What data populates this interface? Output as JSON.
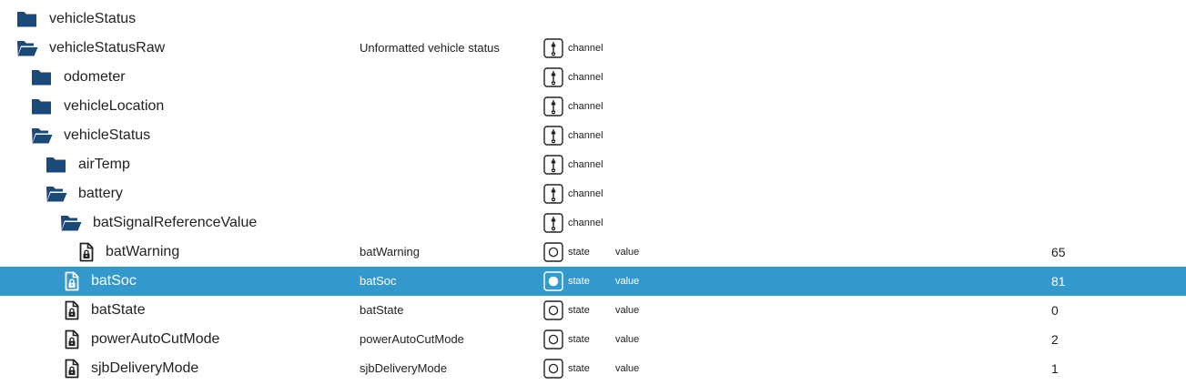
{
  "colors": {
    "folder": "#1b4a7a",
    "selected_bg": "#3399cc",
    "text": "#222222",
    "selected_text": "#ffffff"
  },
  "rows": [
    {
      "name": "vehicleStatus",
      "desc": "",
      "icon": "folder-closed-icon",
      "type": "",
      "type_icon": "",
      "role": "",
      "value": ""
    },
    {
      "name": "vehicleStatusRaw",
      "desc": "Unformatted vehicle status",
      "icon": "folder-open-icon",
      "type": "channel",
      "type_icon": "channel-icon",
      "role": "",
      "value": ""
    },
    {
      "name": "odometer",
      "desc": "",
      "icon": "folder-closed-icon",
      "type": "channel",
      "type_icon": "channel-icon",
      "role": "",
      "value": ""
    },
    {
      "name": "vehicleLocation",
      "desc": "",
      "icon": "folder-closed-icon",
      "type": "channel",
      "type_icon": "channel-icon",
      "role": "",
      "value": ""
    },
    {
      "name": "vehicleStatus",
      "desc": "",
      "icon": "folder-open-icon",
      "type": "channel",
      "type_icon": "channel-icon",
      "role": "",
      "value": ""
    },
    {
      "name": "airTemp",
      "desc": "",
      "icon": "folder-closed-icon",
      "type": "channel",
      "type_icon": "channel-icon",
      "role": "",
      "value": ""
    },
    {
      "name": "battery",
      "desc": "",
      "icon": "folder-open-icon",
      "type": "channel",
      "type_icon": "channel-icon",
      "role": "",
      "value": ""
    },
    {
      "name": "batSignalReferenceValue",
      "desc": "",
      "icon": "folder-open-icon",
      "type": "channel",
      "type_icon": "channel-icon",
      "role": "",
      "value": ""
    },
    {
      "name": "batWarning",
      "desc": "batWarning",
      "icon": "file-lock-icon",
      "type": "state",
      "type_icon": "state-icon",
      "role": "value",
      "value": "65"
    },
    {
      "name": "batSoc",
      "desc": "batSoc",
      "icon": "file-lock-icon",
      "type": "state",
      "type_icon": "state-icon",
      "role": "value",
      "value": "81",
      "selected": true
    },
    {
      "name": "batState",
      "desc": "batState",
      "icon": "file-lock-icon",
      "type": "state",
      "type_icon": "state-icon",
      "role": "value",
      "value": "0"
    },
    {
      "name": "powerAutoCutMode",
      "desc": "powerAutoCutMode",
      "icon": "file-lock-icon",
      "type": "state",
      "type_icon": "state-icon",
      "role": "value",
      "value": "2"
    },
    {
      "name": "sjbDeliveryMode",
      "desc": "sjbDeliveryMode",
      "icon": "file-lock-icon",
      "type": "state",
      "type_icon": "state-icon",
      "role": "value",
      "value": "1"
    }
  ]
}
